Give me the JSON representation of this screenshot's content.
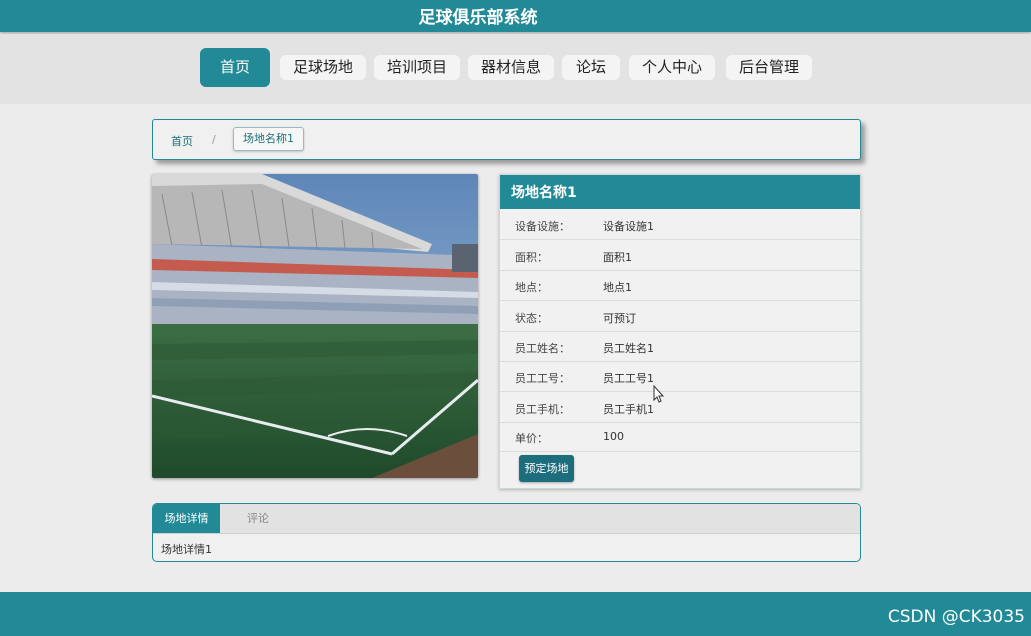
{
  "header": {
    "site_title": "足球俱乐部系统"
  },
  "nav": {
    "items": [
      "首页",
      "足球场地",
      "培训项目",
      "器材信息",
      "论坛",
      "个人中心",
      "后台管理"
    ],
    "active_index": 0
  },
  "breadcrumb": {
    "home": "首页",
    "separator": "/",
    "current": "场地名称1"
  },
  "image": {
    "description": "football-stadium-photo"
  },
  "detail": {
    "title": "场地名称1",
    "rows": [
      {
        "label": "设备设施：",
        "value": "设备设施1"
      },
      {
        "label": "面积：",
        "value": "面积1"
      },
      {
        "label": "地点：",
        "value": "地点1"
      },
      {
        "label": "状态：",
        "value": "可预订"
      },
      {
        "label": "员工姓名：",
        "value": "员工姓名1"
      },
      {
        "label": "员工工号：",
        "value": "员工工号1"
      },
      {
        "label": "员工手机：",
        "value": "员工手机1"
      },
      {
        "label": "单价：",
        "value": "100"
      }
    ],
    "book_button": "预定场地"
  },
  "tabs": {
    "items": [
      "场地详情",
      "评论"
    ],
    "active_index": 0,
    "content": "场地详情1"
  },
  "footer": {
    "watermark": "CSDN @CK3035"
  },
  "colors": {
    "primary": "#218a96",
    "button_dark": "#1d6e7d",
    "background": "#ececec"
  }
}
